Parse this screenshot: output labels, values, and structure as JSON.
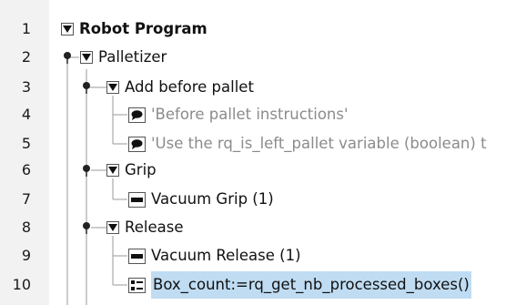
{
  "program_tree": {
    "rows": [
      {
        "num": "1",
        "label": "Robot Program",
        "node_type": "root",
        "expanded": true
      },
      {
        "num": "2",
        "label": "Palletizer",
        "node_type": "folder",
        "expanded": true
      },
      {
        "num": "3",
        "label": "Add before pallet",
        "node_type": "folder",
        "expanded": true
      },
      {
        "num": "4",
        "label": "'Before pallet instructions'",
        "node_type": "comment"
      },
      {
        "num": "5",
        "label": "'Use the rq_is_left_pallet variable (boolean) t",
        "node_type": "comment"
      },
      {
        "num": "6",
        "label": "Grip",
        "node_type": "folder",
        "expanded": true
      },
      {
        "num": "7",
        "label": "Vacuum Grip  (1)",
        "node_type": "command"
      },
      {
        "num": "8",
        "label": "Release",
        "node_type": "folder",
        "expanded": true
      },
      {
        "num": "9",
        "label": "Vacuum Release  (1)",
        "node_type": "command"
      },
      {
        "num": "10",
        "label": "Box_count:=rq_get_nb_processed_boxes()",
        "node_type": "assignment",
        "selected": true
      }
    ]
  },
  "colors": {
    "selection_bg": "#bfdcf2",
    "gutter_bg": "#f2f2f2",
    "comment_text": "#8b8b8b"
  }
}
